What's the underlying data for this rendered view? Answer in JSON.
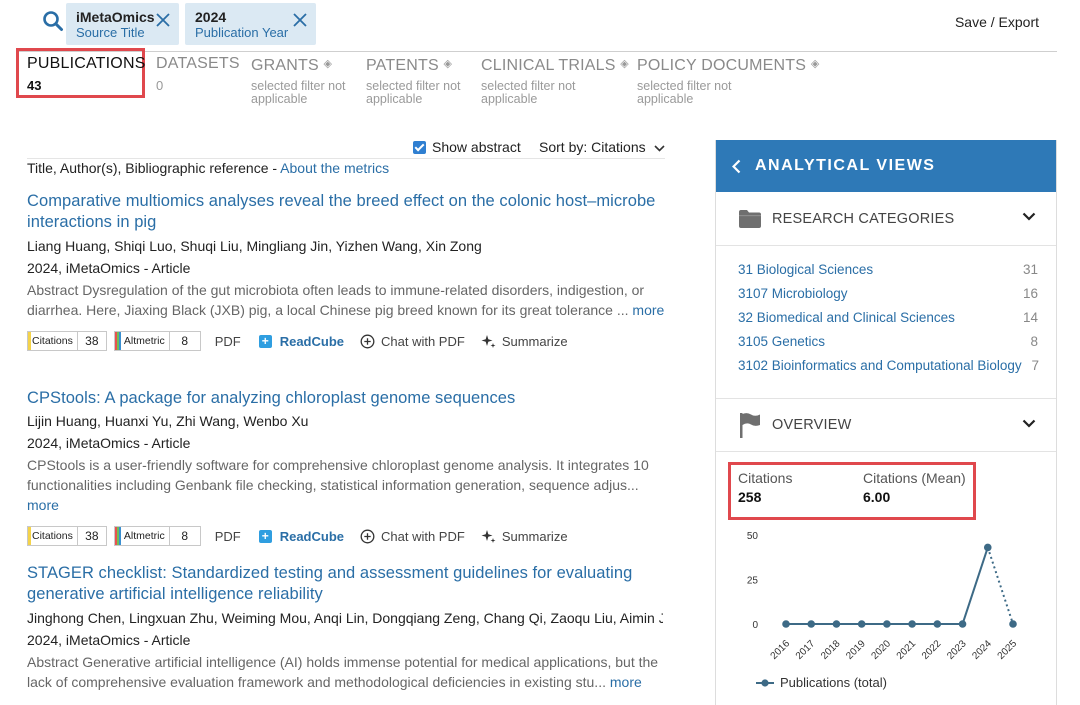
{
  "filters": [
    {
      "value": "iMetaOmics",
      "field": "Source Title"
    },
    {
      "value": "2024",
      "field": "Publication Year"
    }
  ],
  "save_export": "Save / Export",
  "tabs": [
    {
      "name": "PUBLICATIONS",
      "value": "43",
      "active": true
    },
    {
      "name": "DATASETS",
      "value": "0"
    },
    {
      "name": "GRANTS",
      "na": "selected filter not applicable"
    },
    {
      "name": "PATENTS",
      "na": "selected filter not applicable"
    },
    {
      "name": "CLINICAL TRIALS",
      "na": "selected filter not applicable"
    },
    {
      "name": "POLICY DOCUMENTS",
      "na": "selected filter not applicable"
    }
  ],
  "controls": {
    "show_abstract": "Show abstract",
    "sort_by": "Sort by:",
    "sort_value": "Citations"
  },
  "list_header": {
    "text": "Title, Author(s), Bibliographic reference -",
    "link": "About the metrics"
  },
  "results": [
    {
      "title": "Comparative multiomics analyses reveal the breed effect on the colonic host–microbe interactions in pig",
      "authors": "Liang Huang, Shiqi Luo, Shuqi Liu, Mingliang Jin, Yizhen Wang, Xin Zong",
      "meta": "2024, iMetaOmics - Article",
      "abstract": "Abstract Dysregulation of the gut microbiota often leads to immune-related disorders, indigestion, or diarrhea. Here, Jiaxing Black (JXB) pig, a local Chinese pig breed known for its great tolerance ...",
      "more": "more",
      "citations": "38",
      "altmetric": "8"
    },
    {
      "title": "CPStools: A package for analyzing chloroplast genome sequences",
      "authors": "Lijin Huang, Huanxi Yu, Zhi Wang, Wenbo Xu",
      "meta": "2024, iMetaOmics - Article",
      "abstract": "CPStools is a user-friendly software for comprehensive chloroplast genome analysis. It integrates 10 functionalities including Genbank file checking, statistical information generation, sequence adjus...",
      "more": "more",
      "citations": "38",
      "altmetric": "8"
    },
    {
      "title": "STAGER checklist: Standardized testing and assessment guidelines for evaluating generative artificial intelligence reliability",
      "authors": "Jinghong Chen, Lingxuan Zhu, Weiming Mou, Anqi Lin, Dongqiang Zeng, Chang Qi, Zaoqu Liu, Aimin Jian...",
      "meta": "2024, iMetaOmics - Article",
      "abstract": "Abstract Generative artificial intelligence (AI) holds immense potential for medical applications, but the lack of comprehensive evaluation framework and methodological deficiencies in existing stu...",
      "more": "more"
    }
  ],
  "actions": {
    "citations_label": "Citations",
    "altmetric_label": "Altmetric",
    "pdf": "PDF",
    "readcube": "ReadCube",
    "chat": "Chat with PDF",
    "summarize": "Summarize"
  },
  "panel": {
    "title": "ANALYTICAL VIEWS",
    "research_categories": "RESEARCH CATEGORIES",
    "categories": [
      {
        "name": "31 Biological Sciences",
        "count": "31"
      },
      {
        "name": "3107 Microbiology",
        "count": "16"
      },
      {
        "name": "32 Biomedical and Clinical Sciences",
        "count": "14"
      },
      {
        "name": "3105 Genetics",
        "count": "8"
      },
      {
        "name": "3102 Bioinformatics and Computational Biology",
        "count": "7"
      }
    ],
    "overview": "OVERVIEW",
    "citations_label": "Citations",
    "citations_value": "258",
    "mean_label": "Citations (Mean)",
    "mean_value": "6.00"
  },
  "chart_data": {
    "type": "line",
    "x": [
      "2016",
      "2017",
      "2018",
      "2019",
      "2020",
      "2021",
      "2022",
      "2023",
      "2024",
      "2025"
    ],
    "series": [
      {
        "name": "Publications (total)",
        "values": [
          0,
          0,
          0,
          0,
          0,
          0,
          0,
          0,
          43,
          0
        ]
      }
    ],
    "yticks": [
      "0",
      "25",
      "50"
    ],
    "ylim": [
      0,
      50
    ],
    "last_segment_dotted": true,
    "color": "#3d6a86"
  },
  "colors": {
    "accent": "#2a6ea6",
    "panel_header": "#2e79b7",
    "highlight": "#e0484d",
    "chip": "#dbe9f3"
  }
}
